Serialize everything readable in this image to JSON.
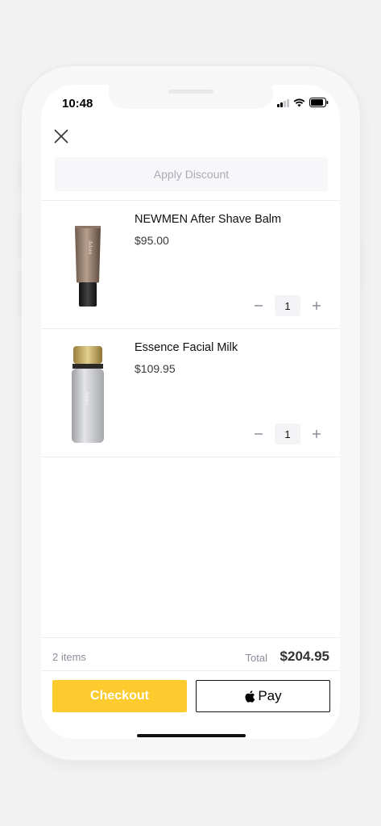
{
  "status_bar": {
    "time": "10:48"
  },
  "discount": {
    "label": "Apply Discount"
  },
  "cart": {
    "items": [
      {
        "name": "NEWMEN After Shave Balm",
        "price": "$95.00",
        "quantity": "1",
        "brand": "Adore"
      },
      {
        "name": "Essence Facial Milk",
        "price": "$109.95",
        "quantity": "1",
        "brand": "Adore"
      }
    ]
  },
  "summary": {
    "count": "2 items",
    "total_label": "Total",
    "total_value": "$204.95"
  },
  "actions": {
    "checkout_label": "Checkout",
    "applepay_label": "Pay"
  },
  "colors": {
    "accent": "#fdcb2e",
    "background": "#f2f2f3"
  }
}
